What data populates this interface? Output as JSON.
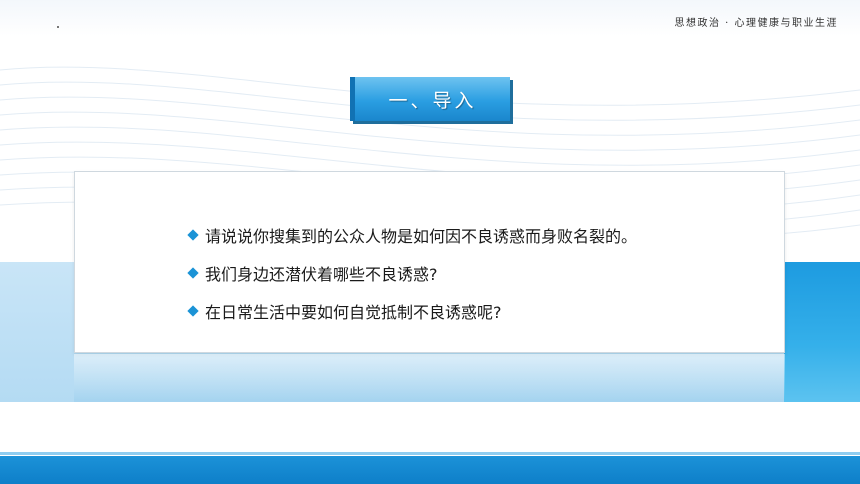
{
  "header": {
    "subtitle": "思想政治 · 心理健康与职业生涯"
  },
  "title": {
    "label": "一、导入"
  },
  "questions": [
    {
      "text": "请说说你搜集到的公众人物是如何因不良诱惑而身败名裂的。"
    },
    {
      "text": "我们身边还潜伏着哪些不良诱惑?"
    },
    {
      "text": "在日常生活中要如何自觉抵制不良诱惑呢?"
    }
  ],
  "colors": {
    "accent": "#1b93d6",
    "title_bg": "#2a9ee2",
    "bottom_bar": "#0e7fc9",
    "band": "#b9def4"
  }
}
